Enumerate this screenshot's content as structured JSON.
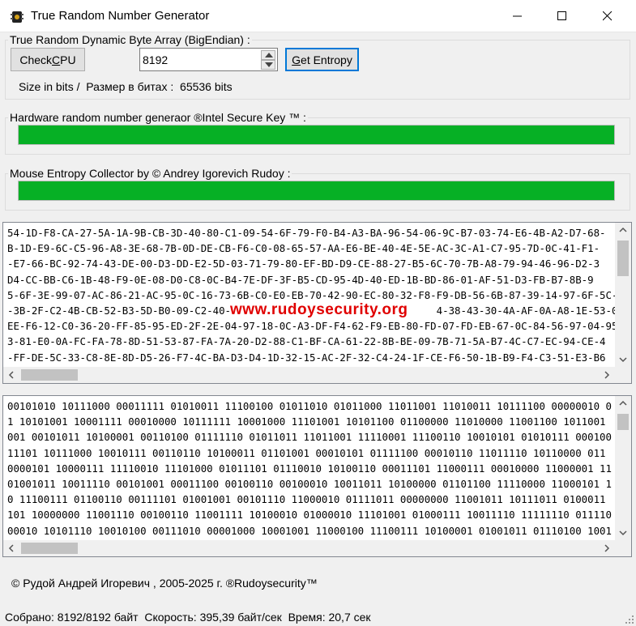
{
  "window": {
    "title": "True Random Number Generator",
    "controls": {
      "minimize_icon": "minimize-icon",
      "maximize_icon": "maximize-icon",
      "close_icon": "close-icon"
    }
  },
  "byte_array_group": {
    "label": "True Random Dynamic Byte Array (BigEndian) :",
    "check_cpu_button": "Check CPU",
    "byte_count_value": "8192",
    "get_entropy_button": "Get Entropy",
    "size_info": "Size in bits /  Размер в битах :  65536 bits"
  },
  "hardware_group": {
    "label": "Hardware random number generaor ®Intel Secure Key ™ :",
    "progress": 1.0
  },
  "mouse_group": {
    "label": "Mouse Entropy Collector by © Andrey Igorevich Rudoy :",
    "progress": 1.0
  },
  "hex_output": {
    "lines": [
      "54-1D-F8-CA-27-5A-1A-9B-CB-3D-40-80-C1-09-54-6F-79-F0-B4-A3-BA-96-54-06-9C-B7-03-74-E6-4B-A2-D7-68-",
      "B-1D-E9-6C-C5-96-A8-3E-68-7B-0D-DE-CB-F6-C0-08-65-57-AA-E6-BE-40-4E-5E-AC-3C-A1-C7-95-7D-0C-41-F1-",
      "-E7-66-BC-92-74-43-DE-00-D3-DD-E2-5D-03-71-79-80-EF-BD-D9-CE-88-27-B5-6C-70-7B-A8-79-94-46-96-D2-3",
      "D4-CC-BB-C6-1B-48-F9-0E-08-D0-C8-0C-B4-7E-DF-3F-B5-CD-95-4D-40-ED-1B-BD-86-01-AF-51-D3-FB-B7-8B-9",
      "5-6F-3E-99-07-AC-86-21-AC-95-0C-16-73-6B-C0-E0-EB-70-42-90-EC-80-32-F8-F9-DB-56-6B-87-39-14-97-6F-5C-",
      "-3B-2F-C2-4B-CB-52-B3-5D-B0-09-C2-40-                                  4-38-43-30-4A-AF-0A-A8-1E-53-01-4A",
      "EE-F6-12-C0-36-20-FF-85-95-ED-2F-2E-04-97-18-0C-A3-DF-F4-62-F9-EB-80-FD-07-FD-EB-67-0C-84-56-97-04-95",
      "3-81-E0-0A-FC-FA-78-8D-51-53-87-FA-7A-20-D2-88-C1-BF-CA-61-22-8B-BE-09-7B-71-5A-B7-4C-C7-EC-94-CE-4",
      "-FF-DE-5C-33-C8-8E-8D-D5-26-F7-4C-BA-D3-D4-1D-32-15-AC-2F-32-C4-24-1F-CE-F6-50-1B-B9-F4-C3-51-E3-B6"
    ],
    "watermark": "www.rudoysecurity.org"
  },
  "binary_output": {
    "lines": [
      "00101010 10111000 00011111 01010011 11100100 01011010 01011000 11011001 11010011 10111100 00000010 0",
      "1 10101001 10001111 00010000 10111111 10001000 11101001 10101100 01100000 11010000 11001100 1011001",
      "001 00101011 10100001 00110100 01111110 01011011 11011001 11110001 11100110 10010101 01010111 000100",
      "11101 10111000 10010111 00110110 10100011 01101001 00010101 01111100 00010110 11011110 10110000 011",
      "0000101 10000111 11110010 11101000 01011101 01110010 10100110 00011101 11000111 00010000 11000001 11",
      "01001011 10011110 00101001 00011100 00100110 00100010 10011011 10100000 01101100 11110000 11000101 1",
      "0 11100111 01100110 00111101 01001001 00101110 11000010 01111011 00000000 11001011 10111011 0100011",
      "101 10000000 11001110 00100110 11001111 10100010 01000010 11101001 01000111 10011110 11111110 011110",
      "00010 10101110 10010100 00111010 00001000 10001001 11000100 11100111 10100001 01001011 01110100 1001"
    ]
  },
  "copyright": "© Рудой Андрей Игоревич , 2005-2025 г.  ®Rudoysecurity™",
  "status": "Собрано: 8192/8192 байт  Скорость: 395,39 байт/сек  Время: 20,7 сек",
  "colors": {
    "progress_green": "#06b025",
    "watermark_red": "#e00000",
    "focus_blue": "#0078d7"
  }
}
